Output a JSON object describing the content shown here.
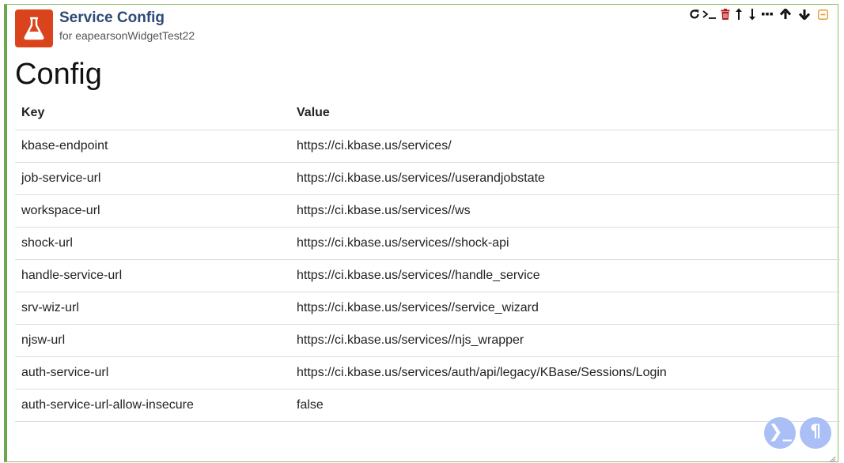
{
  "header": {
    "title": "Service Config",
    "subtitle": "for eapearsonWidgetTest22"
  },
  "toolbar": {
    "icons": [
      "refresh-icon",
      "terminal-icon",
      "trash-icon",
      "move-up-icon",
      "move-down-icon",
      "ellipsis-icon",
      "arrow-up-icon",
      "arrow-down-icon",
      "collapse-icon"
    ],
    "colors": {
      "trash": "#b31f1f",
      "collapse": "#e0a030",
      "default": "#111111"
    }
  },
  "main": {
    "heading": "Config",
    "table": {
      "headers": {
        "key": "Key",
        "value": "Value"
      },
      "rows": [
        {
          "key": "kbase-endpoint",
          "value": "https://ci.kbase.us/services/"
        },
        {
          "key": "job-service-url",
          "value": "https://ci.kbase.us/services//userandjobstate"
        },
        {
          "key": "workspace-url",
          "value": "https://ci.kbase.us/services//ws"
        },
        {
          "key": "shock-url",
          "value": "https://ci.kbase.us/services//shock-api"
        },
        {
          "key": "handle-service-url",
          "value": "https://ci.kbase.us/services//handle_service"
        },
        {
          "key": "srv-wiz-url",
          "value": "https://ci.kbase.us/services//service_wizard"
        },
        {
          "key": "njsw-url",
          "value": "https://ci.kbase.us/services//njs_wrapper"
        },
        {
          "key": "auth-service-url",
          "value": "https://ci.kbase.us/services/auth/api/legacy/KBase/Sessions/Login"
        },
        {
          "key": "auth-service-url-allow-insecure",
          "value": "false"
        }
      ]
    }
  },
  "fabs": {
    "terminal_glyph": "❯_",
    "paragraph_glyph": "¶"
  },
  "colors": {
    "app_icon_bg": "#d9441d",
    "title": "#2e4a75",
    "cell_border": "#6aa84f",
    "fab": "#a9bff5"
  }
}
